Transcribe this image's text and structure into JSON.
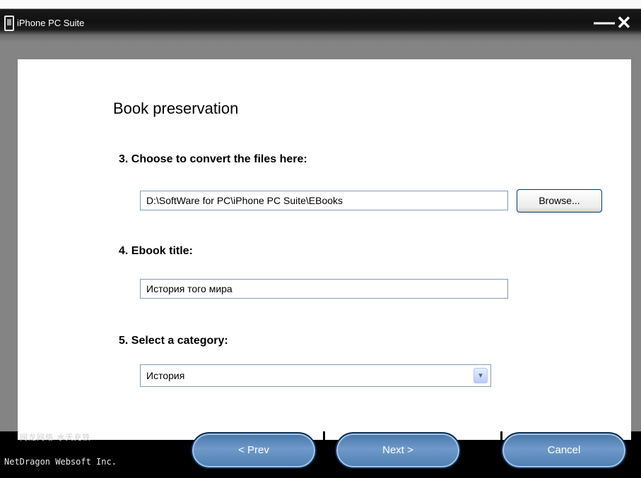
{
  "window": {
    "title": "iPhone PC Suite",
    "minimize_label": "—",
    "close_label": "✕"
  },
  "page": {
    "heading": "Book preservation"
  },
  "step3": {
    "label": "3. Choose to convert the files here:",
    "path": "D:\\SoftWare for PC\\iPhone PC Suite\\EBooks",
    "browse_label": "Browse..."
  },
  "step4": {
    "label": "4. Ebook title:",
    "value": "История того мира"
  },
  "step5": {
    "label": "5. Select a category:",
    "selected": "История",
    "arrow": "▾"
  },
  "footer": {
    "logo_text": "网龙网络 水天充铁",
    "company": "NetDragon Websoft Inc."
  },
  "buttons": {
    "prev": "< Prev",
    "next": "Next >",
    "cancel": "Cancel"
  },
  "icons": {
    "app": "phone-icon",
    "minimize": "minimize-icon",
    "close": "close-icon",
    "dropdown": "chevron-down-icon"
  }
}
